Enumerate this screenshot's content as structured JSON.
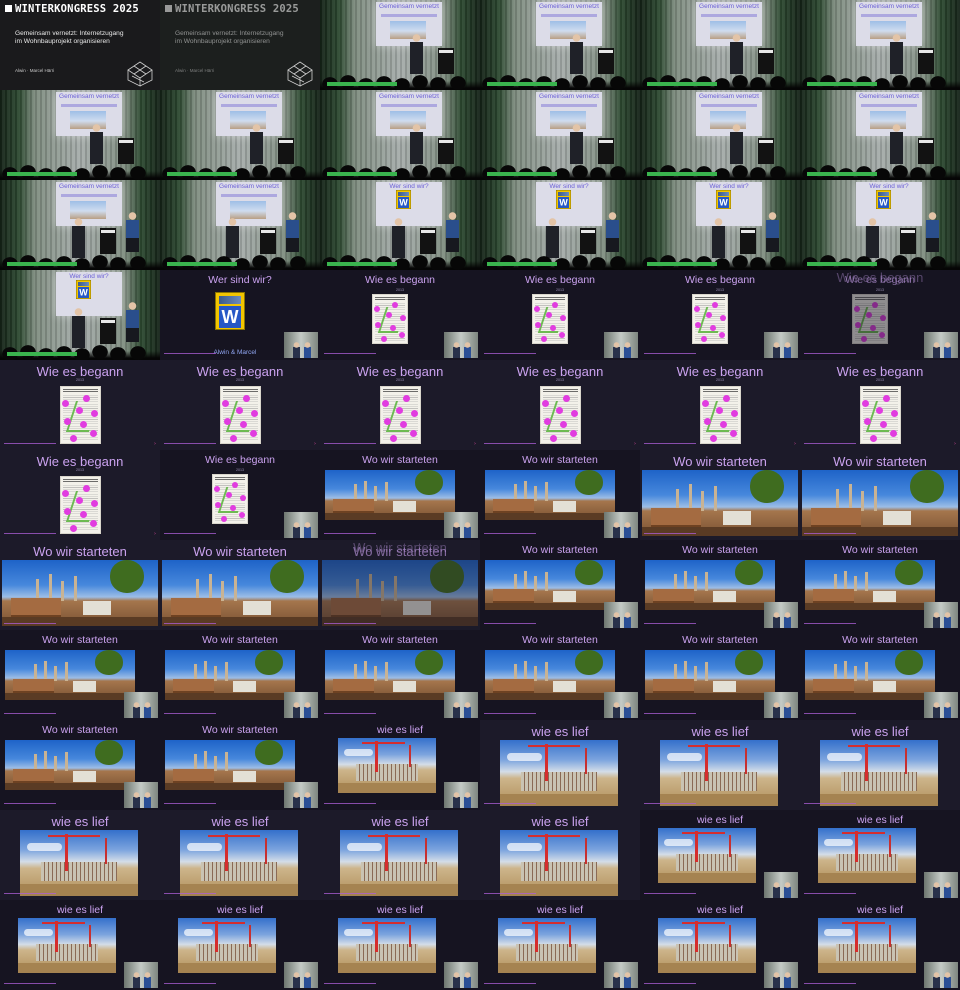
{
  "contact_sheet": {
    "columns": 6,
    "rows": 11,
    "frame_count": 66
  },
  "event": {
    "brand": "WINTERKONGRESS 2025",
    "talk_title": "Gemeinsam vernetzt: Internetzugang im Wohnbauprojekt organisieren",
    "speakers": "Alwin · Marcel Härri"
  },
  "slides": {
    "intro": "Gemeinsam vernetzt",
    "who": "Wer sind wir?",
    "who_caption": "Alwin & Marcel",
    "began": "Wie es begann",
    "began_sub": "2013",
    "started": "Wo wir starteten",
    "went": "wie es lief"
  },
  "colors": {
    "slide_background": "#1c1a29",
    "slide_heading": "#caa2ef",
    "caption": "#8fa4f0",
    "lower_third": "#3ab44e",
    "poster_marker": "#e13ce0",
    "accent": "#ad5fd8"
  },
  "frames": [
    {
      "type": "intro",
      "variant": "plain"
    },
    {
      "type": "intro",
      "variant": "fade"
    },
    {
      "type": "stage",
      "screen": "intro",
      "people": 1
    },
    {
      "type": "stage",
      "screen": "intro",
      "people": 1
    },
    {
      "type": "stage",
      "screen": "intro",
      "people": 1
    },
    {
      "type": "stage",
      "screen": "intro",
      "people": 1
    },
    {
      "type": "stage",
      "screen": "intro",
      "people": 1
    },
    {
      "type": "stage",
      "screen": "intro",
      "people": 1
    },
    {
      "type": "stage",
      "screen": "intro",
      "people": 1
    },
    {
      "type": "stage",
      "screen": "intro",
      "people": 1
    },
    {
      "type": "stage",
      "screen": "intro",
      "people": 1
    },
    {
      "type": "stage",
      "screen": "intro",
      "people": 1
    },
    {
      "type": "stage",
      "screen": "intro",
      "people": 2
    },
    {
      "type": "stage",
      "screen": "intro",
      "people": 2
    },
    {
      "type": "stage",
      "screen": "who",
      "people": 2
    },
    {
      "type": "stage",
      "screen": "who",
      "people": 2
    },
    {
      "type": "stage",
      "screen": "who",
      "people": 2
    },
    {
      "type": "stage",
      "screen": "who",
      "people": 2
    },
    {
      "type": "stage",
      "screen": "who",
      "people": 2
    },
    {
      "type": "slide",
      "key": "who",
      "visual": "book",
      "caption": true,
      "pip": true,
      "size": "m"
    },
    {
      "type": "slide",
      "key": "began",
      "visual": "poster",
      "sub": true,
      "pip": true,
      "size": "m"
    },
    {
      "type": "slide",
      "key": "began",
      "visual": "poster",
      "sub": true,
      "pip": true,
      "size": "m"
    },
    {
      "type": "slide",
      "key": "began",
      "visual": "poster",
      "sub": true,
      "pip": true,
      "size": "m"
    },
    {
      "type": "slide",
      "key": "began",
      "visual": "poster",
      "sub": true,
      "pip": true,
      "size": "m",
      "ghost": true
    },
    {
      "type": "slide",
      "key": "began",
      "visual": "poster",
      "sub": true,
      "size": "l",
      "arrow": true
    },
    {
      "type": "slide",
      "key": "began",
      "visual": "poster",
      "sub": true,
      "size": "l",
      "arrow": true
    },
    {
      "type": "slide",
      "key": "began",
      "visual": "poster",
      "sub": true,
      "size": "l",
      "arrow": true
    },
    {
      "type": "slide",
      "key": "began",
      "visual": "poster",
      "sub": true,
      "size": "l",
      "arrow": true
    },
    {
      "type": "slide",
      "key": "began",
      "visual": "poster",
      "sub": true,
      "size": "l",
      "arrow": true
    },
    {
      "type": "slide",
      "key": "began",
      "visual": "poster",
      "sub": true,
      "size": "l",
      "arrow": true
    },
    {
      "type": "slide",
      "key": "began",
      "visual": "poster",
      "sub": true,
      "size": "l",
      "arrow": true
    },
    {
      "type": "slide",
      "key": "began",
      "visual": "poster",
      "sub": true,
      "pip": true,
      "size": "m"
    },
    {
      "type": "slide",
      "key": "started",
      "visual": "plant",
      "pip": true,
      "size": "m"
    },
    {
      "type": "slide",
      "key": "started",
      "visual": "plant",
      "pip": true,
      "size": "m"
    },
    {
      "type": "slide",
      "key": "started",
      "visual": "plant",
      "size": "l",
      "wide": true
    },
    {
      "type": "slide",
      "key": "started",
      "visual": "plant",
      "size": "l",
      "wide": true
    },
    {
      "type": "slide",
      "key": "started",
      "visual": "plant",
      "size": "l",
      "wide": true
    },
    {
      "type": "slide",
      "key": "started",
      "visual": "plant",
      "size": "l",
      "wide": true
    },
    {
      "type": "slide",
      "key": "started",
      "visual": "plant",
      "size": "l",
      "wide": true,
      "ghost": true
    },
    {
      "type": "slide",
      "key": "started",
      "visual": "plant",
      "pip": true,
      "size": "m"
    },
    {
      "type": "slide",
      "key": "started",
      "visual": "plant",
      "pip": true,
      "size": "m"
    },
    {
      "type": "slide",
      "key": "started",
      "visual": "plant",
      "pip": true,
      "size": "m"
    },
    {
      "type": "slide",
      "key": "started",
      "visual": "plant",
      "pip": true,
      "size": "m"
    },
    {
      "type": "slide",
      "key": "started",
      "visual": "plant",
      "pip": true,
      "size": "m"
    },
    {
      "type": "slide",
      "key": "started",
      "visual": "plant",
      "pip": true,
      "size": "m"
    },
    {
      "type": "slide",
      "key": "started",
      "visual": "plant",
      "pip": true,
      "size": "m"
    },
    {
      "type": "slide",
      "key": "started",
      "visual": "plant",
      "pip": true,
      "size": "m"
    },
    {
      "type": "slide",
      "key": "started",
      "visual": "plant",
      "pip": true,
      "size": "m"
    },
    {
      "type": "slide",
      "key": "started",
      "visual": "plant",
      "pip": true,
      "size": "m"
    },
    {
      "type": "slide",
      "key": "started",
      "visual": "plant",
      "pip": true,
      "size": "m"
    },
    {
      "type": "slide",
      "key": "went",
      "visual": "site",
      "pip": true,
      "size": "m"
    },
    {
      "type": "slide",
      "key": "went",
      "visual": "site",
      "size": "l"
    },
    {
      "type": "slide",
      "key": "went",
      "visual": "site",
      "size": "l"
    },
    {
      "type": "slide",
      "key": "went",
      "visual": "site",
      "size": "l"
    },
    {
      "type": "slide",
      "key": "went",
      "visual": "site",
      "size": "l"
    },
    {
      "type": "slide",
      "key": "went",
      "visual": "site",
      "size": "l"
    },
    {
      "type": "slide",
      "key": "went",
      "visual": "site",
      "size": "l"
    },
    {
      "type": "slide",
      "key": "went",
      "visual": "site",
      "size": "l"
    },
    {
      "type": "slide",
      "key": "went",
      "visual": "site",
      "pip": true,
      "size": "m"
    },
    {
      "type": "slide",
      "key": "went",
      "visual": "site",
      "pip": true,
      "size": "m"
    },
    {
      "type": "slide",
      "key": "went",
      "visual": "site",
      "pip": true,
      "size": "m"
    },
    {
      "type": "slide",
      "key": "went",
      "visual": "site",
      "pip": true,
      "size": "m"
    },
    {
      "type": "slide",
      "key": "went",
      "visual": "site",
      "pip": true,
      "size": "m"
    },
    {
      "type": "slide",
      "key": "went",
      "visual": "site",
      "pip": true,
      "size": "m"
    },
    {
      "type": "slide",
      "key": "went",
      "visual": "site",
      "pip": true,
      "size": "m"
    },
    {
      "type": "slide",
      "key": "went",
      "visual": "site",
      "pip": true,
      "size": "m"
    }
  ]
}
